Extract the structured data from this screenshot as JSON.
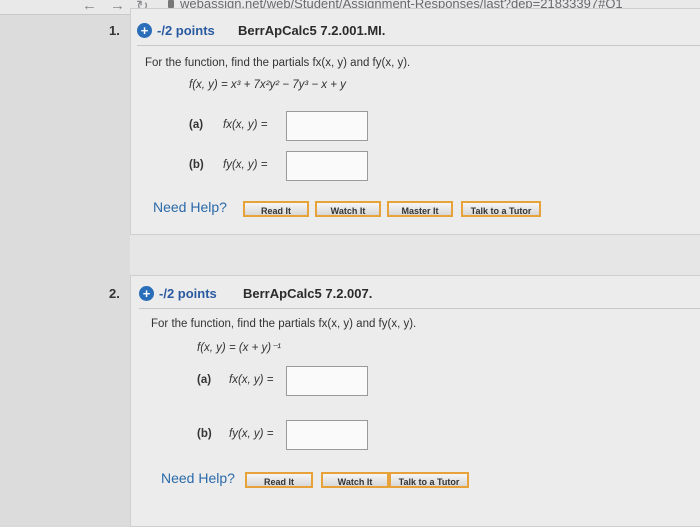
{
  "browser": {
    "url": "webassign.net/web/Student/Assignment-Responses/last?dep=21833397#Q1"
  },
  "questions": [
    {
      "number": "1.",
      "points": "-/2 points",
      "id": "BerrApCalc5 7.2.001.MI.",
      "prompt": "For the function, find the partials fx(x, y) and fy(x, y).",
      "function": "f(x, y) = x³ + 7x²y² − 7y³ − x + y",
      "parts": [
        {
          "label": "(a)",
          "expr": "fx(x, y) =",
          "value": ""
        },
        {
          "label": "(b)",
          "expr": "fy(x, y) =",
          "value": ""
        }
      ],
      "need_help": "Need Help?",
      "help_buttons": [
        "Read It",
        "Watch It",
        "Master It",
        "Talk to a Tutor"
      ]
    },
    {
      "number": "2.",
      "points": "-/2 points",
      "id": "BerrApCalc5 7.2.007.",
      "prompt": "For the function, find the partials fx(x, y) and fy(x, y).",
      "function": "f(x, y) = (x + y)⁻¹",
      "parts": [
        {
          "label": "(a)",
          "expr": "fx(x, y) =",
          "value": ""
        },
        {
          "label": "(b)",
          "expr": "fy(x, y) =",
          "value": ""
        }
      ],
      "need_help": "Need Help?",
      "help_buttons": [
        "Read It",
        "Watch It",
        "Talk to a Tutor"
      ]
    }
  ]
}
